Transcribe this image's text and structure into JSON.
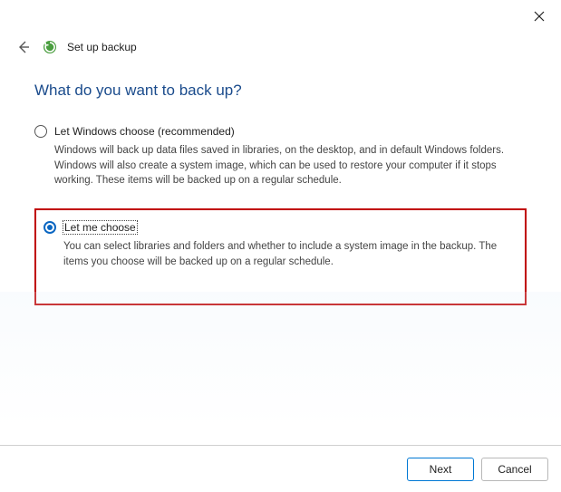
{
  "window": {
    "title": "Set up backup"
  },
  "page": {
    "heading": "What do you want to back up?"
  },
  "options": {
    "windows_choose": {
      "label": "Let Windows choose (recommended)",
      "description": "Windows will back up data files saved in libraries, on the desktop, and in default Windows folders. Windows will also create a system image, which can be used to restore your computer if it stops working. These items will be backed up on a regular schedule.",
      "selected": false
    },
    "let_me_choose": {
      "label": "Let me choose",
      "description": "You can select libraries and folders and whether to include a system image in the backup. The items you choose will be backed up on a regular schedule.",
      "selected": true
    }
  },
  "buttons": {
    "next": "Next",
    "cancel": "Cancel"
  }
}
